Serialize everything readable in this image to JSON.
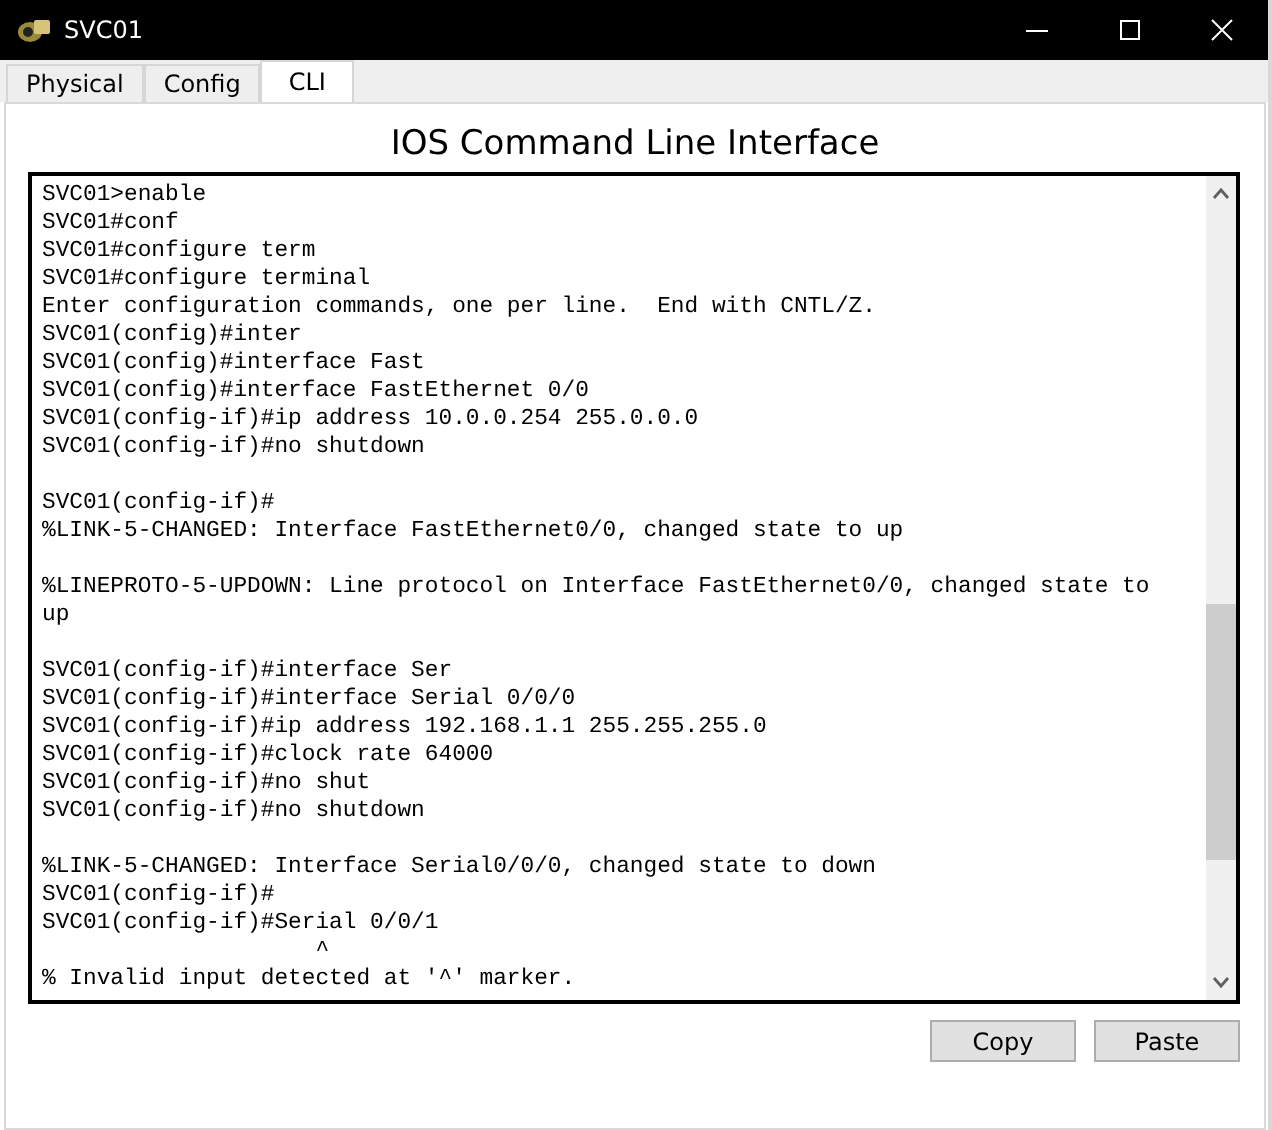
{
  "window": {
    "title": "SVC01"
  },
  "tabs": [
    {
      "label": "Physical",
      "selected": false
    },
    {
      "label": "Config",
      "selected": false
    },
    {
      "label": "CLI",
      "selected": true
    }
  ],
  "heading": "IOS Command Line Interface",
  "terminal": {
    "blocks": [
      [
        "SVC01>enable",
        "SVC01#conf",
        "SVC01#configure term",
        "SVC01#configure terminal",
        "Enter configuration commands, one per line.  End with CNTL/Z.",
        "SVC01(config)#inter",
        "SVC01(config)#interface Fast",
        "SVC01(config)#interface FastEthernet 0/0",
        "SVC01(config-if)#ip address 10.0.0.254 255.0.0.0",
        "SVC01(config-if)#no shutdown"
      ],
      [
        "SVC01(config-if)#",
        "%LINK-5-CHANGED: Interface FastEthernet0/0, changed state to up"
      ],
      [
        "%LINEPROTO-5-UPDOWN: Line protocol on Interface FastEthernet0/0, changed state to",
        "up"
      ],
      [
        "SVC01(config-if)#interface Ser",
        "SVC01(config-if)#interface Serial 0/0/0",
        "SVC01(config-if)#ip address 192.168.1.1 255.255.255.0",
        "SVC01(config-if)#clock rate 64000",
        "SVC01(config-if)#no shut",
        "SVC01(config-if)#no shutdown"
      ],
      [
        "%LINK-5-CHANGED: Interface Serial0/0/0, changed state to down",
        "SVC01(config-if)#",
        "SVC01(config-if)#Serial 0/0/1",
        "                    ^",
        "% Invalid input detected at '^' marker."
      ]
    ]
  },
  "buttons": [
    "Copy",
    "Paste"
  ]
}
